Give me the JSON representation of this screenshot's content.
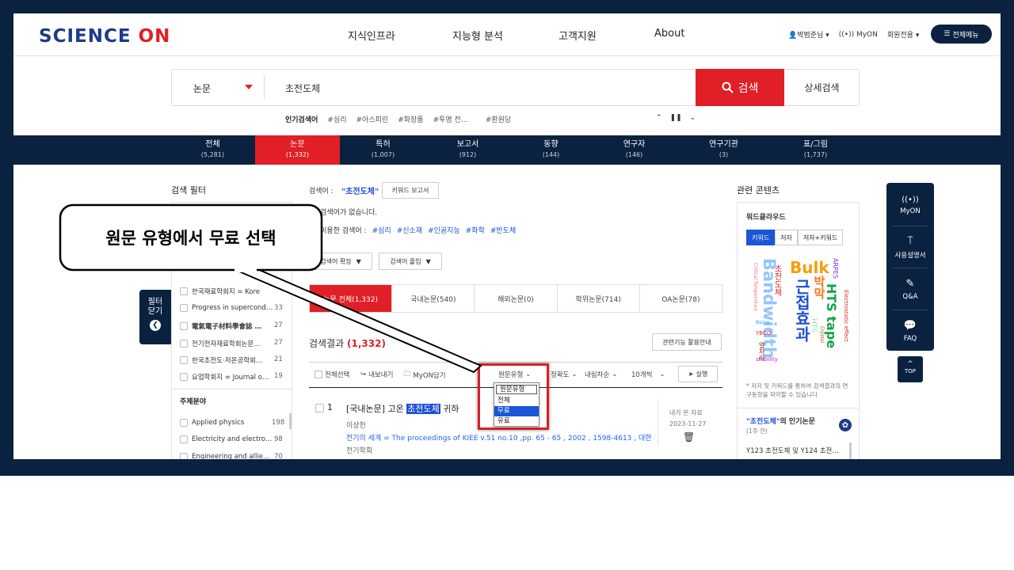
{
  "header": {
    "logo_main": "SCIENCE",
    "logo_accent": "ON",
    "nav": [
      "지식인프라",
      "지능형 분석",
      "고객지원",
      "About"
    ],
    "user": "박범준님",
    "myon": "MyON",
    "member": "회원전용",
    "all_menu": "전체메뉴"
  },
  "search": {
    "category": "논문",
    "query": "초전도체",
    "button": "검색",
    "advanced": "상세검색",
    "popular_label": "인기검색어",
    "popular": [
      "#심리",
      "#아스피린",
      "#화장품",
      "#투명 전…",
      "#환원당"
    ]
  },
  "tabs": [
    {
      "label": "전체",
      "count": "(5,281)"
    },
    {
      "label": "논문",
      "count": "(1,332)"
    },
    {
      "label": "특허",
      "count": "(1,007)"
    },
    {
      "label": "보고서",
      "count": "(912)"
    },
    {
      "label": "동향",
      "count": "(144)"
    },
    {
      "label": "연구자",
      "count": "(146)"
    },
    {
      "label": "연구기관",
      "count": "(3)"
    },
    {
      "label": "표/그림",
      "count": "(1,737)"
    }
  ],
  "filter": {
    "title": "검색 필터",
    "close": "필터 닫기",
    "journals": [
      {
        "name": "한국재료학회지 = Kore",
        "count": ""
      },
      {
        "name": "Progress in supercond…",
        "count": "33"
      },
      {
        "name": "電氣電子材料學會誌 …",
        "count": "27"
      },
      {
        "name": "전기전자재료학회논문…",
        "count": "27"
      },
      {
        "name": "한국초전도·저온공학회…",
        "count": "21"
      },
      {
        "name": "요업학회지 = Journal o…",
        "count": "19"
      }
    ],
    "subject_title": "주제분야",
    "subjects": [
      {
        "name": "Applied physics",
        "count": "198"
      },
      {
        "name": "Electricity and electro…",
        "count": "98"
      },
      {
        "name": "Engineering and allie…",
        "count": "70"
      }
    ]
  },
  "results": {
    "term_label": "검색어 :",
    "term": "\"초전도체\"",
    "keyword_report": "키워드 보고서",
    "no_related": "관 검색어가 없습니다.",
    "used_label": "께 이용한 검색어 :",
    "used_terms": [
      "#심리",
      "#신소재",
      "#인공지능",
      "#화학",
      "#반도체"
    ],
    "expand": "검색어 확장",
    "narrow": "검색어 줄임",
    "subtabs": [
      "논문 전체(1,332)",
      "국내논문(540)",
      "해외논문(0)",
      "학위논문(714)",
      "OA논문(78)"
    ],
    "count_label": "검색결과",
    "count": "(1,332)",
    "guide": "관련기능 활용안내",
    "toolbar": {
      "select_all": "전체선택",
      "export": "내보내기",
      "myon_save": "MyON담기",
      "source_type": "원문유형",
      "accuracy": "정확도",
      "order": "내림차순",
      "per_page": "10개씩",
      "run": "실행"
    },
    "dropdown": [
      "원문유형",
      "전체",
      "무료",
      "유료"
    ],
    "item": {
      "num": "1",
      "prefix": "[국내논문] 고온",
      "highlight": "초전도체",
      "suffix": "귀하",
      "author": "이상헌",
      "source": "전기의 세계 = The proceedings of KIEE v.51 no.10 ,pp. 65 - 65 , 2002 , 1598-4613 , 대한",
      "publisher": "전기학회",
      "viewed_label": "내가 본 자료",
      "viewed_date": "2023-11-27"
    }
  },
  "related": {
    "title": "관련 콘텐츠",
    "wordcloud_title": "워드클라우드",
    "wc_tabs": [
      "키워드",
      "저자",
      "저자+키워드"
    ],
    "words": [
      "Bulk",
      "Bandwidth",
      "근접효과",
      "HTS tape",
      "ARPES",
      "박막",
      "초전도체",
      "YBCO",
      "stability",
      "Critical Temperature",
      "Electrostatic effect",
      "HTS",
      "Crystal",
      "열처리",
      "Bscco"
    ],
    "note": "* 저자 및 키워드를 통하여 검색결과의 연구동향을 파악할 수 있습니다",
    "popular_term": "\"초전도체\"",
    "popular_suffix": "의 인기논문",
    "popular_period": "(1주 전)",
    "popular_item": "Y123 초전도체 및 Y124 초전…"
  },
  "sidebar": {
    "items": [
      "MyON",
      "사용설명서",
      "Q&A",
      "FAQ"
    ],
    "top": "TOP"
  },
  "callout": {
    "text": "원문 유형에서 무료 선택"
  }
}
